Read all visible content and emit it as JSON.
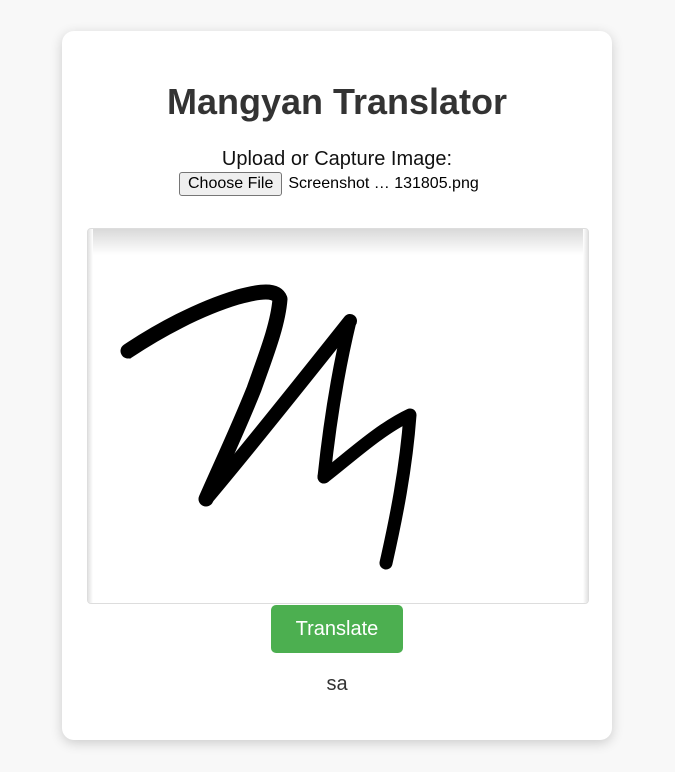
{
  "app": {
    "title": "Mangyan Translator"
  },
  "upload": {
    "label": "Upload or Capture Image:",
    "button_label": "Choose File",
    "file_name": "Screenshot … 131805.png"
  },
  "preview": {
    "alt": "Handwritten Mangyan character"
  },
  "actions": {
    "translate_label": "Translate"
  },
  "result": {
    "text": "sa"
  },
  "colors": {
    "page_background": "#f8f8f8",
    "card_background": "#ffffff",
    "title_text": "#333333",
    "translate_button": "#4caf50",
    "translate_button_text": "#ffffff"
  }
}
